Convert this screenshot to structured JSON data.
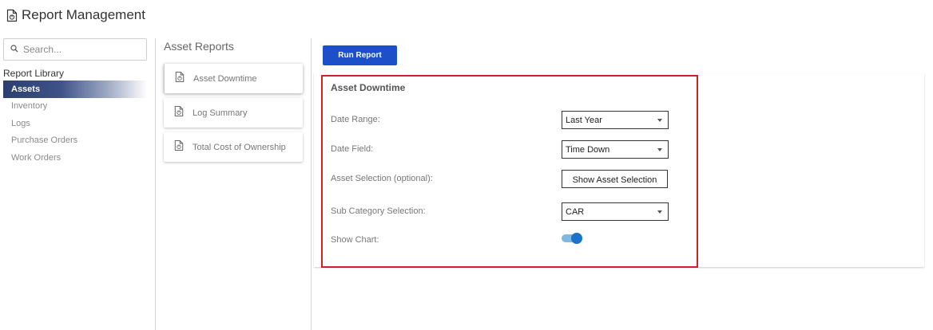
{
  "app": {
    "title": "Report Management",
    "icon": "doc-icon"
  },
  "sidebar": {
    "search_placeholder": "Search...",
    "library_title": "Report Library",
    "items": [
      {
        "label": "Assets",
        "active": true
      },
      {
        "label": "Inventory",
        "active": false
      },
      {
        "label": "Logs",
        "active": false
      },
      {
        "label": "Purchase Orders",
        "active": false
      },
      {
        "label": "Work Orders",
        "active": false
      }
    ]
  },
  "reports": {
    "title": "Asset Reports",
    "items": [
      {
        "label": "Asset Downtime",
        "selected": true
      },
      {
        "label": "Log Summary",
        "selected": false
      },
      {
        "label": "Total Cost of Ownership",
        "selected": false
      }
    ]
  },
  "toolbar": {
    "run_label": "Run Report",
    "run_color": "#1d4fc8"
  },
  "params": {
    "title": "Asset Downtime",
    "date_range": {
      "label": "Date Range:",
      "value": "Last Year"
    },
    "date_field": {
      "label": "Date Field:",
      "value": "Time Down"
    },
    "asset_selection": {
      "label": "Asset Selection (optional):",
      "button": "Show Asset Selection"
    },
    "sub_category": {
      "label": "Sub Category Selection:",
      "value": "CAR"
    },
    "show_chart": {
      "label": "Show Chart:",
      "on": true
    },
    "highlight_color": "#d0202a"
  }
}
